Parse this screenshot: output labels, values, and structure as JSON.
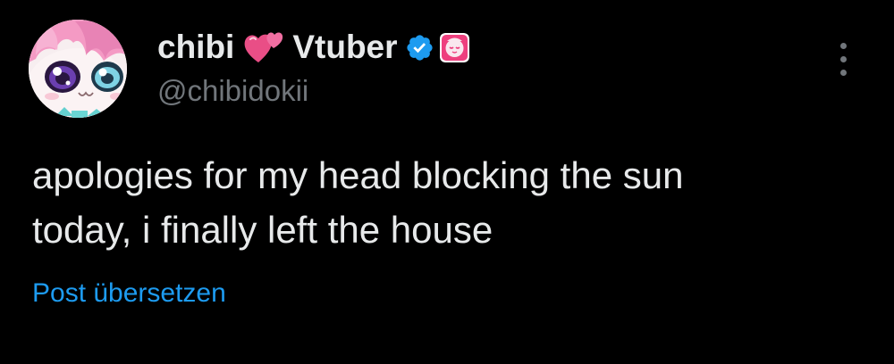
{
  "author": {
    "display_name_first": "chibi",
    "display_name_emoji": "two-hearts-emoji",
    "display_name_second": "Vtuber",
    "handle": "@chibidokii",
    "verified_icon": "verified-checkmark-icon",
    "affiliate_icon": "affiliate-badge-icon"
  },
  "post": {
    "text": "apologies for my head blocking the sun\ntoday, i finally left the house",
    "translate_label": "Post übersetzen"
  },
  "more_icon": "more-options-icon",
  "colors": {
    "background": "#000000",
    "primary_text": "#e7e9ea",
    "secondary_text": "#71767b",
    "link": "#1d9bf0",
    "verified": "#1d9bf0",
    "affiliate_badge": "#ee3f7e"
  }
}
